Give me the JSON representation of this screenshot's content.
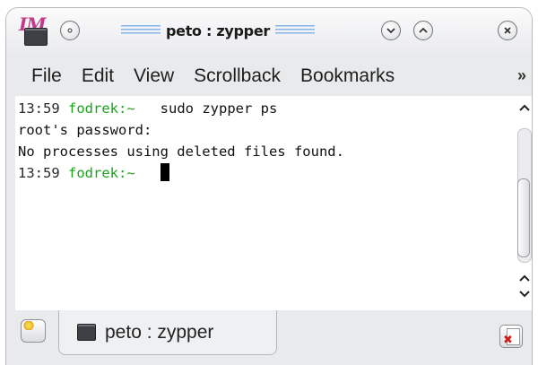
{
  "window": {
    "title": "peto : zypper",
    "app_icon": "terminal-icon",
    "app_logo_text": "IM"
  },
  "menubar": {
    "items": [
      "File",
      "Edit",
      "View",
      "Scrollback",
      "Bookmarks"
    ],
    "overflow": "»"
  },
  "terminal": {
    "lines": [
      {
        "time": "13:59",
        "prompt": "fodrek:~",
        "command": "sudo zypper ps"
      },
      {
        "text": "root's password:"
      },
      {
        "text": "No processes using deleted files found."
      },
      {
        "time": "13:59",
        "prompt": "fodrek:~",
        "command": ""
      }
    ]
  },
  "tabs": [
    {
      "label": "peto : zypper",
      "icon": "terminal-icon"
    }
  ],
  "colors": {
    "prompt": "#1aa31a",
    "logo": "#c23a88"
  }
}
